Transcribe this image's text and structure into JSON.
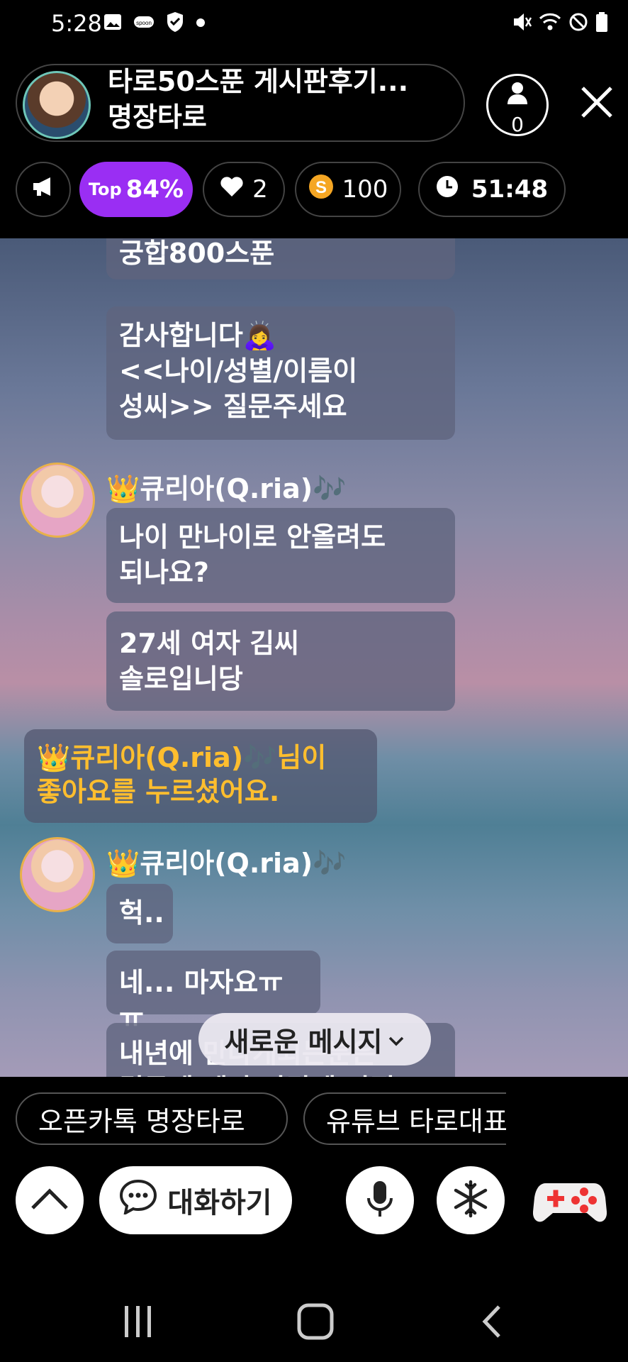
{
  "status_bar": {
    "time": "5:28",
    "notification_icons": [
      "image-icon",
      "spoon-icon",
      "shield-icon",
      "dot-icon"
    ],
    "system_icons": [
      "mute-icon",
      "wifi-icon",
      "block-icon",
      "battery-icon"
    ]
  },
  "room": {
    "title": "타로50스푼 게시판후기...",
    "host_name": "명장타로",
    "listener_count": "0"
  },
  "stats": {
    "top_label": "Top",
    "top_percent": "84%",
    "likes": "2",
    "spoons": "100",
    "timer": "51:48"
  },
  "chat": {
    "messages_top": [
      {
        "text": "궁합800스푼"
      },
      {
        "lines": [
          "감사합니다🙇‍♀️",
          "<<나이/성별/이름이",
          "성씨>> 질문주세요"
        ]
      }
    ],
    "user1": {
      "name": "👑큐리아(Q.ria)🎶",
      "messages": [
        {
          "lines": [
            "나이 만나이로 안올려도",
            "되나요?"
          ]
        },
        {
          "lines": [
            "27세 여자 김씨",
            "솔로입니당"
          ]
        }
      ]
    },
    "like_notice": {
      "line1": "👑큐리아(Q.ria)🎶님이",
      "line2": "좋아요를 누르셨어요."
    },
    "user2": {
      "name": "👑큐리아(Q.ria)🎶",
      "messages": [
        {
          "text": "헉.."
        },
        {
          "text": "네... 마자요ㅠㅠ"
        },
        {
          "lines": [
            "내년에 만나게되는분은",
            "결국에 제가 사랑에 빠질"
          ]
        }
      ]
    },
    "new_message_label": "새로운 메시지"
  },
  "quick_chips": [
    "오픈카톡 명장타로",
    "유튜브 타로대표"
  ],
  "bottom_bar": {
    "talk_label": "대화하기"
  },
  "colors": {
    "accent_purple": "#9a2ef3",
    "spoon_orange": "#f5a623",
    "notice_gold": "#ffbe2e"
  }
}
